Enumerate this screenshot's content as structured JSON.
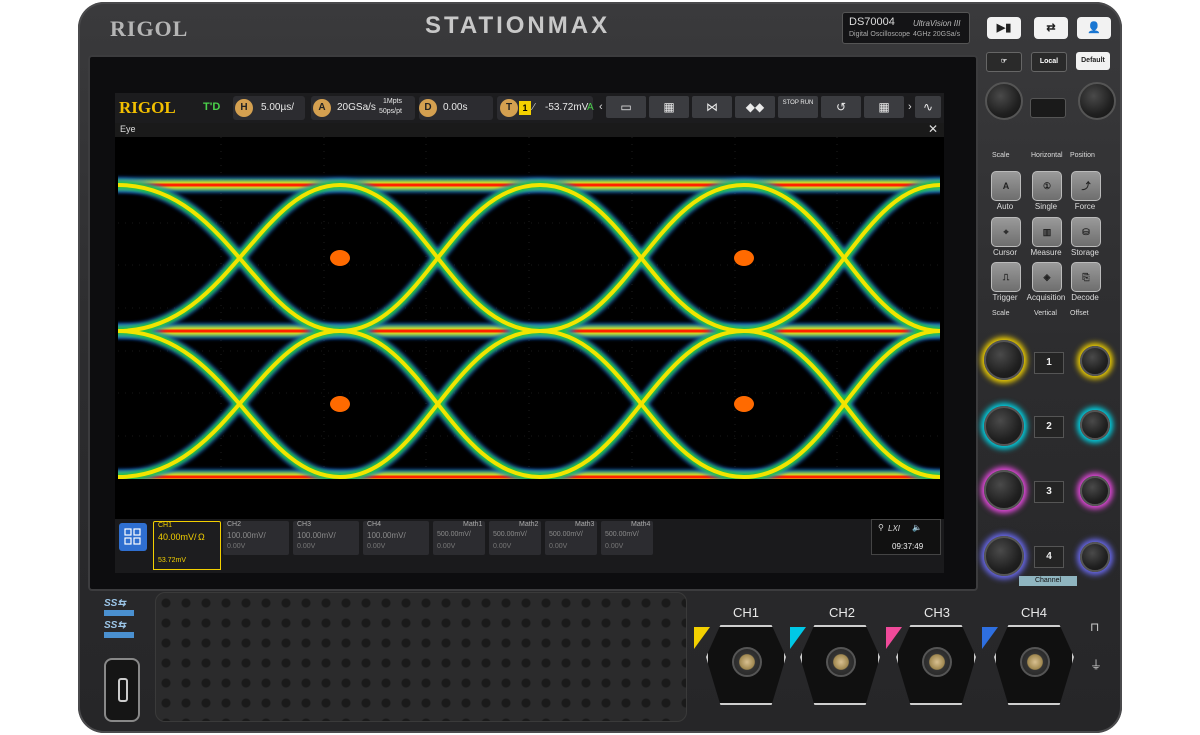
{
  "device": {
    "brand": "RIGOL",
    "series": "STATIONMAX",
    "model": "DS70004",
    "model_sub": "Digital Oscilloscope",
    "tech": "UltraVision III",
    "spec": "4GHz 20GSa/s"
  },
  "panel_buttons": {
    "local": "Local",
    "default": "Default"
  },
  "topbar": {
    "logo": "RIGOL",
    "run_state": "T'D",
    "h_letter": "H",
    "timebase": "5.00µs/",
    "a_letter": "A",
    "sample_rate": "20GSa/s",
    "mem_depth": "1Mpts",
    "points_rate": "50ps/pt",
    "d_letter": "D",
    "delay": "0.00s",
    "t_letter": "T",
    "trig_source": "1",
    "trig_level": "-53.72mV",
    "trig_mode": "A",
    "stop_run_label": "STOP RUN"
  },
  "window": {
    "title": "Eye",
    "close": "✕"
  },
  "channels": [
    {
      "name": "CH1",
      "scale": "40.00mV/",
      "offset": "53.72mV",
      "coupling": "Ω",
      "color": "#f3d000"
    },
    {
      "name": "CH2",
      "scale": "100.00mV/",
      "offset": "0.00V"
    },
    {
      "name": "CH3",
      "scale": "100.00mV/",
      "offset": "0.00V"
    },
    {
      "name": "CH4",
      "scale": "100.00mV/",
      "offset": "0.00V"
    }
  ],
  "math": [
    {
      "name": "Math1",
      "scale": "500.00mV/",
      "offset": "0.00V"
    },
    {
      "name": "Math2",
      "scale": "500.00mV/",
      "offset": "0.00V"
    },
    {
      "name": "Math3",
      "scale": "500.00mV/",
      "offset": "0.00V"
    },
    {
      "name": "Math4",
      "scale": "500.00mV/",
      "offset": "0.00V"
    }
  ],
  "status": {
    "lxi": "LXI",
    "time": "09:37:49"
  },
  "right_panel": {
    "horizontal": {
      "scale": "Scale",
      "title": "Horizontal",
      "position": "Position"
    },
    "buttons": [
      {
        "label": "Auto",
        "icon": "auto-icon"
      },
      {
        "label": "Single",
        "icon": "single-icon"
      },
      {
        "label": "Force",
        "icon": "force-icon"
      },
      {
        "label": "Cursor",
        "icon": "cursor-icon"
      },
      {
        "label": "Measure",
        "icon": "measure-icon"
      },
      {
        "label": "Storage",
        "icon": "storage-icon"
      },
      {
        "label": "Trigger",
        "icon": "trigger-icon"
      },
      {
        "label": "Acquisition",
        "icon": "acquisition-icon"
      },
      {
        "label": "Decode",
        "icon": "decode-icon"
      }
    ],
    "vertical": {
      "scale": "Scale",
      "title": "Vertical",
      "offset": "Offset"
    },
    "channel_numbers": [
      "1",
      "2",
      "3",
      "4"
    ],
    "channel_tag": "Channel"
  },
  "front_inputs": [
    "CH1",
    "CH2",
    "CH3",
    "CH4"
  ],
  "colors": {
    "ch1": "#f3d000",
    "ch2": "#00c8e6",
    "ch3": "#f04a9a",
    "ch4": "#2e6fe0",
    "accent": "#f3c000"
  }
}
